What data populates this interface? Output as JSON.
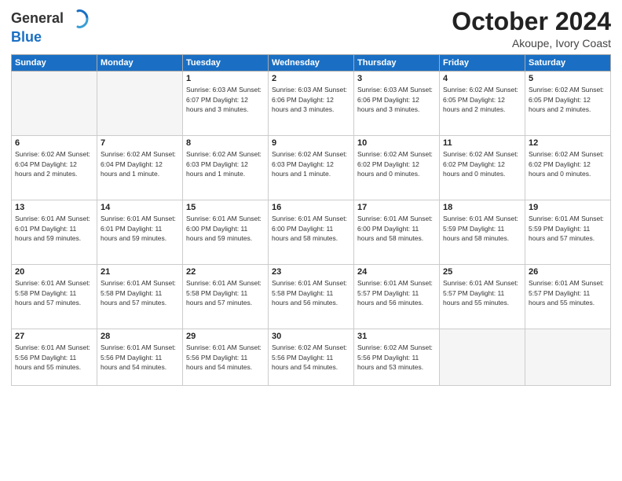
{
  "logo": {
    "general": "General",
    "blue": "Blue"
  },
  "header": {
    "month": "October 2024",
    "location": "Akoupe, Ivory Coast"
  },
  "weekdays": [
    "Sunday",
    "Monday",
    "Tuesday",
    "Wednesday",
    "Thursday",
    "Friday",
    "Saturday"
  ],
  "weeks": [
    [
      {
        "day": "",
        "info": ""
      },
      {
        "day": "",
        "info": ""
      },
      {
        "day": "1",
        "info": "Sunrise: 6:03 AM\nSunset: 6:07 PM\nDaylight: 12 hours\nand 3 minutes."
      },
      {
        "day": "2",
        "info": "Sunrise: 6:03 AM\nSunset: 6:06 PM\nDaylight: 12 hours\nand 3 minutes."
      },
      {
        "day": "3",
        "info": "Sunrise: 6:03 AM\nSunset: 6:06 PM\nDaylight: 12 hours\nand 3 minutes."
      },
      {
        "day": "4",
        "info": "Sunrise: 6:02 AM\nSunset: 6:05 PM\nDaylight: 12 hours\nand 2 minutes."
      },
      {
        "day": "5",
        "info": "Sunrise: 6:02 AM\nSunset: 6:05 PM\nDaylight: 12 hours\nand 2 minutes."
      }
    ],
    [
      {
        "day": "6",
        "info": "Sunrise: 6:02 AM\nSunset: 6:04 PM\nDaylight: 12 hours\nand 2 minutes."
      },
      {
        "day": "7",
        "info": "Sunrise: 6:02 AM\nSunset: 6:04 PM\nDaylight: 12 hours\nand 1 minute."
      },
      {
        "day": "8",
        "info": "Sunrise: 6:02 AM\nSunset: 6:03 PM\nDaylight: 12 hours\nand 1 minute."
      },
      {
        "day": "9",
        "info": "Sunrise: 6:02 AM\nSunset: 6:03 PM\nDaylight: 12 hours\nand 1 minute."
      },
      {
        "day": "10",
        "info": "Sunrise: 6:02 AM\nSunset: 6:02 PM\nDaylight: 12 hours\nand 0 minutes."
      },
      {
        "day": "11",
        "info": "Sunrise: 6:02 AM\nSunset: 6:02 PM\nDaylight: 12 hours\nand 0 minutes."
      },
      {
        "day": "12",
        "info": "Sunrise: 6:02 AM\nSunset: 6:02 PM\nDaylight: 12 hours\nand 0 minutes."
      }
    ],
    [
      {
        "day": "13",
        "info": "Sunrise: 6:01 AM\nSunset: 6:01 PM\nDaylight: 11 hours\nand 59 minutes."
      },
      {
        "day": "14",
        "info": "Sunrise: 6:01 AM\nSunset: 6:01 PM\nDaylight: 11 hours\nand 59 minutes."
      },
      {
        "day": "15",
        "info": "Sunrise: 6:01 AM\nSunset: 6:00 PM\nDaylight: 11 hours\nand 59 minutes."
      },
      {
        "day": "16",
        "info": "Sunrise: 6:01 AM\nSunset: 6:00 PM\nDaylight: 11 hours\nand 58 minutes."
      },
      {
        "day": "17",
        "info": "Sunrise: 6:01 AM\nSunset: 6:00 PM\nDaylight: 11 hours\nand 58 minutes."
      },
      {
        "day": "18",
        "info": "Sunrise: 6:01 AM\nSunset: 5:59 PM\nDaylight: 11 hours\nand 58 minutes."
      },
      {
        "day": "19",
        "info": "Sunrise: 6:01 AM\nSunset: 5:59 PM\nDaylight: 11 hours\nand 57 minutes."
      }
    ],
    [
      {
        "day": "20",
        "info": "Sunrise: 6:01 AM\nSunset: 5:58 PM\nDaylight: 11 hours\nand 57 minutes."
      },
      {
        "day": "21",
        "info": "Sunrise: 6:01 AM\nSunset: 5:58 PM\nDaylight: 11 hours\nand 57 minutes."
      },
      {
        "day": "22",
        "info": "Sunrise: 6:01 AM\nSunset: 5:58 PM\nDaylight: 11 hours\nand 57 minutes."
      },
      {
        "day": "23",
        "info": "Sunrise: 6:01 AM\nSunset: 5:58 PM\nDaylight: 11 hours\nand 56 minutes."
      },
      {
        "day": "24",
        "info": "Sunrise: 6:01 AM\nSunset: 5:57 PM\nDaylight: 11 hours\nand 56 minutes."
      },
      {
        "day": "25",
        "info": "Sunrise: 6:01 AM\nSunset: 5:57 PM\nDaylight: 11 hours\nand 55 minutes."
      },
      {
        "day": "26",
        "info": "Sunrise: 6:01 AM\nSunset: 5:57 PM\nDaylight: 11 hours\nand 55 minutes."
      }
    ],
    [
      {
        "day": "27",
        "info": "Sunrise: 6:01 AM\nSunset: 5:56 PM\nDaylight: 11 hours\nand 55 minutes."
      },
      {
        "day": "28",
        "info": "Sunrise: 6:01 AM\nSunset: 5:56 PM\nDaylight: 11 hours\nand 54 minutes."
      },
      {
        "day": "29",
        "info": "Sunrise: 6:01 AM\nSunset: 5:56 PM\nDaylight: 11 hours\nand 54 minutes."
      },
      {
        "day": "30",
        "info": "Sunrise: 6:02 AM\nSunset: 5:56 PM\nDaylight: 11 hours\nand 54 minutes."
      },
      {
        "day": "31",
        "info": "Sunrise: 6:02 AM\nSunset: 5:56 PM\nDaylight: 11 hours\nand 53 minutes."
      },
      {
        "day": "",
        "info": ""
      },
      {
        "day": "",
        "info": ""
      }
    ]
  ]
}
